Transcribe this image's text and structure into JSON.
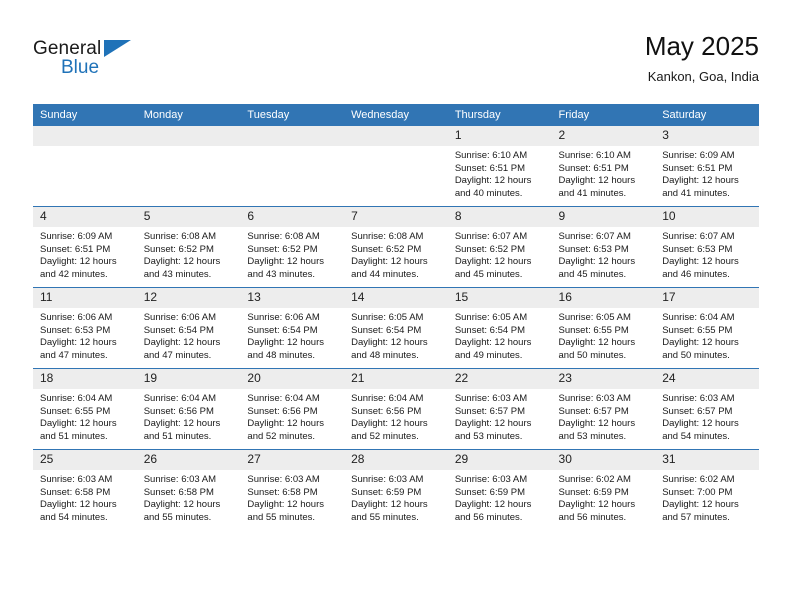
{
  "brand": {
    "word_one": "General",
    "word_two": "Blue",
    "triangle_icon": "triangle-icon",
    "color_blue": "#1f72b8",
    "color_dark": "#1a1a1a"
  },
  "header": {
    "title": "May 2025",
    "location": "Kankon, Goa, India"
  },
  "theme": {
    "header_blue": "#3175b4",
    "daynum_band": "#ededed",
    "text": "#1a1a1a"
  },
  "calendar": {
    "weekday_headers": [
      "Sunday",
      "Monday",
      "Tuesday",
      "Wednesday",
      "Thursday",
      "Friday",
      "Saturday"
    ],
    "labels": {
      "sunrise": "Sunrise:",
      "sunset": "Sunset:",
      "daylight": "Daylight:"
    },
    "weeks": [
      [
        {
          "day": "",
          "sunrise": "",
          "sunset": "",
          "daylight": "",
          "empty": true
        },
        {
          "day": "",
          "sunrise": "",
          "sunset": "",
          "daylight": "",
          "empty": true
        },
        {
          "day": "",
          "sunrise": "",
          "sunset": "",
          "daylight": "",
          "empty": true
        },
        {
          "day": "",
          "sunrise": "",
          "sunset": "",
          "daylight": "",
          "empty": true
        },
        {
          "day": "1",
          "sunrise": "Sunrise: 6:10 AM",
          "sunset": "Sunset: 6:51 PM",
          "daylight": "Daylight: 12 hours and 40 minutes."
        },
        {
          "day": "2",
          "sunrise": "Sunrise: 6:10 AM",
          "sunset": "Sunset: 6:51 PM",
          "daylight": "Daylight: 12 hours and 41 minutes."
        },
        {
          "day": "3",
          "sunrise": "Sunrise: 6:09 AM",
          "sunset": "Sunset: 6:51 PM",
          "daylight": "Daylight: 12 hours and 41 minutes."
        }
      ],
      [
        {
          "day": "4",
          "sunrise": "Sunrise: 6:09 AM",
          "sunset": "Sunset: 6:51 PM",
          "daylight": "Daylight: 12 hours and 42 minutes."
        },
        {
          "day": "5",
          "sunrise": "Sunrise: 6:08 AM",
          "sunset": "Sunset: 6:52 PM",
          "daylight": "Daylight: 12 hours and 43 minutes."
        },
        {
          "day": "6",
          "sunrise": "Sunrise: 6:08 AM",
          "sunset": "Sunset: 6:52 PM",
          "daylight": "Daylight: 12 hours and 43 minutes."
        },
        {
          "day": "7",
          "sunrise": "Sunrise: 6:08 AM",
          "sunset": "Sunset: 6:52 PM",
          "daylight": "Daylight: 12 hours and 44 minutes."
        },
        {
          "day": "8",
          "sunrise": "Sunrise: 6:07 AM",
          "sunset": "Sunset: 6:52 PM",
          "daylight": "Daylight: 12 hours and 45 minutes."
        },
        {
          "day": "9",
          "sunrise": "Sunrise: 6:07 AM",
          "sunset": "Sunset: 6:53 PM",
          "daylight": "Daylight: 12 hours and 45 minutes."
        },
        {
          "day": "10",
          "sunrise": "Sunrise: 6:07 AM",
          "sunset": "Sunset: 6:53 PM",
          "daylight": "Daylight: 12 hours and 46 minutes."
        }
      ],
      [
        {
          "day": "11",
          "sunrise": "Sunrise: 6:06 AM",
          "sunset": "Sunset: 6:53 PM",
          "daylight": "Daylight: 12 hours and 47 minutes."
        },
        {
          "day": "12",
          "sunrise": "Sunrise: 6:06 AM",
          "sunset": "Sunset: 6:54 PM",
          "daylight": "Daylight: 12 hours and 47 minutes."
        },
        {
          "day": "13",
          "sunrise": "Sunrise: 6:06 AM",
          "sunset": "Sunset: 6:54 PM",
          "daylight": "Daylight: 12 hours and 48 minutes."
        },
        {
          "day": "14",
          "sunrise": "Sunrise: 6:05 AM",
          "sunset": "Sunset: 6:54 PM",
          "daylight": "Daylight: 12 hours and 48 minutes."
        },
        {
          "day": "15",
          "sunrise": "Sunrise: 6:05 AM",
          "sunset": "Sunset: 6:54 PM",
          "daylight": "Daylight: 12 hours and 49 minutes."
        },
        {
          "day": "16",
          "sunrise": "Sunrise: 6:05 AM",
          "sunset": "Sunset: 6:55 PM",
          "daylight": "Daylight: 12 hours and 50 minutes."
        },
        {
          "day": "17",
          "sunrise": "Sunrise: 6:04 AM",
          "sunset": "Sunset: 6:55 PM",
          "daylight": "Daylight: 12 hours and 50 minutes."
        }
      ],
      [
        {
          "day": "18",
          "sunrise": "Sunrise: 6:04 AM",
          "sunset": "Sunset: 6:55 PM",
          "daylight": "Daylight: 12 hours and 51 minutes."
        },
        {
          "day": "19",
          "sunrise": "Sunrise: 6:04 AM",
          "sunset": "Sunset: 6:56 PM",
          "daylight": "Daylight: 12 hours and 51 minutes."
        },
        {
          "day": "20",
          "sunrise": "Sunrise: 6:04 AM",
          "sunset": "Sunset: 6:56 PM",
          "daylight": "Daylight: 12 hours and 52 minutes."
        },
        {
          "day": "21",
          "sunrise": "Sunrise: 6:04 AM",
          "sunset": "Sunset: 6:56 PM",
          "daylight": "Daylight: 12 hours and 52 minutes."
        },
        {
          "day": "22",
          "sunrise": "Sunrise: 6:03 AM",
          "sunset": "Sunset: 6:57 PM",
          "daylight": "Daylight: 12 hours and 53 minutes."
        },
        {
          "day": "23",
          "sunrise": "Sunrise: 6:03 AM",
          "sunset": "Sunset: 6:57 PM",
          "daylight": "Daylight: 12 hours and 53 minutes."
        },
        {
          "day": "24",
          "sunrise": "Sunrise: 6:03 AM",
          "sunset": "Sunset: 6:57 PM",
          "daylight": "Daylight: 12 hours and 54 minutes."
        }
      ],
      [
        {
          "day": "25",
          "sunrise": "Sunrise: 6:03 AM",
          "sunset": "Sunset: 6:58 PM",
          "daylight": "Daylight: 12 hours and 54 minutes."
        },
        {
          "day": "26",
          "sunrise": "Sunrise: 6:03 AM",
          "sunset": "Sunset: 6:58 PM",
          "daylight": "Daylight: 12 hours and 55 minutes."
        },
        {
          "day": "27",
          "sunrise": "Sunrise: 6:03 AM",
          "sunset": "Sunset: 6:58 PM",
          "daylight": "Daylight: 12 hours and 55 minutes."
        },
        {
          "day": "28",
          "sunrise": "Sunrise: 6:03 AM",
          "sunset": "Sunset: 6:59 PM",
          "daylight": "Daylight: 12 hours and 55 minutes."
        },
        {
          "day": "29",
          "sunrise": "Sunrise: 6:03 AM",
          "sunset": "Sunset: 6:59 PM",
          "daylight": "Daylight: 12 hours and 56 minutes."
        },
        {
          "day": "30",
          "sunrise": "Sunrise: 6:02 AM",
          "sunset": "Sunset: 6:59 PM",
          "daylight": "Daylight: 12 hours and 56 minutes."
        },
        {
          "day": "31",
          "sunrise": "Sunrise: 6:02 AM",
          "sunset": "Sunset: 7:00 PM",
          "daylight": "Daylight: 12 hours and 57 minutes."
        }
      ]
    ]
  }
}
